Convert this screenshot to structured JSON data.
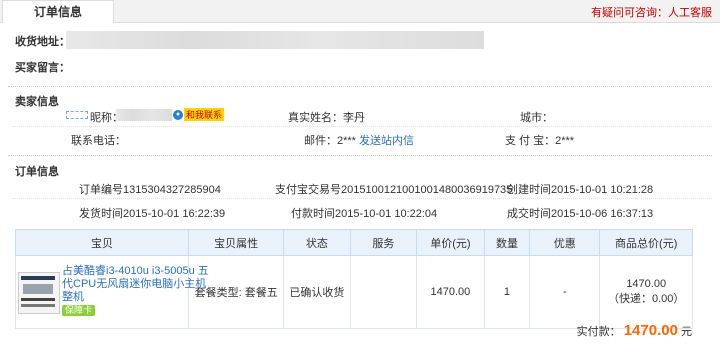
{
  "tab": {
    "title": "订单信息"
  },
  "help": {
    "text": "有疑问可咨询：",
    "service": "人工客服"
  },
  "delivery": {
    "address_label": "收货地址：",
    "message_label": "买家留言："
  },
  "seller": {
    "section_title": "卖家信息",
    "nick_label": "昵称：",
    "chat_label": "和我联系",
    "realname": "真实姓名：李丹",
    "city": "城市：",
    "phone": "联系电话：",
    "email_label": "邮件：",
    "email_value": "2***",
    "email_link": "发送站内信",
    "alipay": "支 付 宝：2***"
  },
  "order": {
    "section_title": "订单信息",
    "order_no": "订单编号1315304327285904",
    "alipay_no": "支付宝交易号2015100121001001480036919735",
    "created": "创建时间2015-10-01 10:21:28",
    "shipped": "发货时间2015-10-01 16:22:39",
    "paid": "付款时间2015-10-01 10:22:04",
    "completed": "成交时间2015-10-06 16:37:13"
  },
  "table": {
    "headers": [
      "宝贝",
      "宝贝属性",
      "状态",
      "服务",
      "单价(元)",
      "数量",
      "优惠",
      "商品总价(元)"
    ],
    "rows": [
      {
        "name": "占美酷睿i3-4010u i3-5005u 五代CPU无风扇迷你电脑小主机整机",
        "badge": "保障卡",
        "attr": "套餐类型: 套餐五",
        "status": "已确认收货",
        "service": "",
        "unit_price": "1470.00",
        "qty": "1",
        "discount": "-",
        "total": "1470.00",
        "shipping": "（快递：0.00）"
      }
    ]
  },
  "summary": {
    "label": "实付款：",
    "amount": "1470.00",
    "unit": "元"
  }
}
